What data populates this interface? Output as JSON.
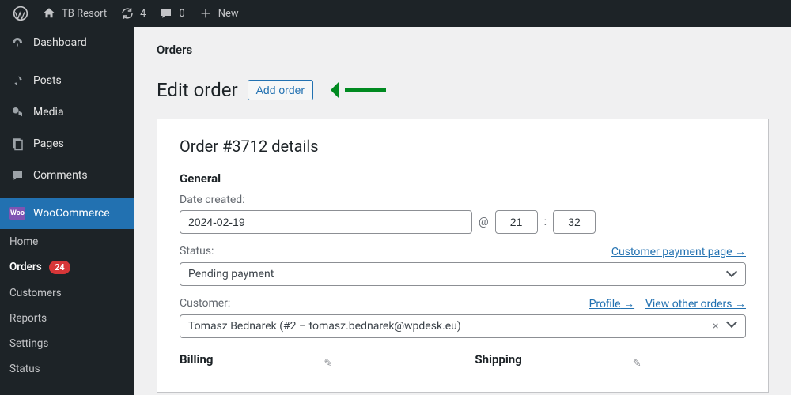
{
  "adminbar": {
    "site_name": "TB Resort",
    "refresh_count": "4",
    "comments_count": "0",
    "new_label": "New"
  },
  "sidebar": {
    "items": [
      {
        "label": "Dashboard"
      },
      {
        "label": "Posts"
      },
      {
        "label": "Media"
      },
      {
        "label": "Pages"
      },
      {
        "label": "Comments"
      },
      {
        "label": "WooCommerce"
      }
    ]
  },
  "submenu": {
    "home": "Home",
    "orders": "Orders",
    "orders_badge": "24",
    "customers": "Customers",
    "reports": "Reports",
    "settings": "Settings",
    "status": "Status"
  },
  "page": {
    "breadcrumb": "Orders",
    "heading": "Edit order",
    "add_btn": "Add order"
  },
  "order": {
    "panel_title": "Order #3712 details",
    "general_label": "General",
    "date_label": "Date created:",
    "date_value": "2024-02-19",
    "at_symbol": "@",
    "hour": "21",
    "colon": ":",
    "minute": "32",
    "status_label": "Status:",
    "payment_page_link": "Customer payment page",
    "status_value": "Pending payment",
    "customer_label": "Customer:",
    "profile_link": "Profile",
    "view_orders_link": "View other orders",
    "customer_value": "Tomasz Bednarek (#2 – tomasz.bednarek@wpdesk.eu)",
    "billing_label": "Billing",
    "shipping_label": "Shipping"
  }
}
